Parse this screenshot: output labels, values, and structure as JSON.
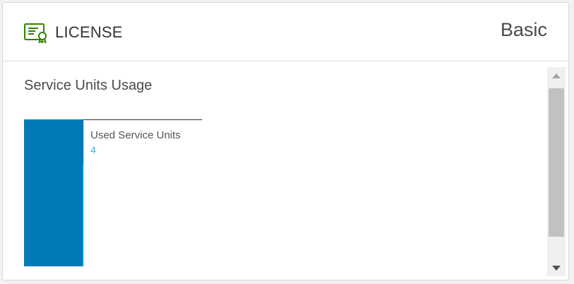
{
  "header": {
    "title": "LICENSE",
    "edition": "Basic",
    "icon": "license-certificate-icon"
  },
  "usage": {
    "section_title": "Service Units Usage",
    "label": "Used Service Units",
    "value": "4"
  },
  "colors": {
    "bar": "#0079b8",
    "value_text": "#49afd9",
    "icon": "#2f8400"
  }
}
